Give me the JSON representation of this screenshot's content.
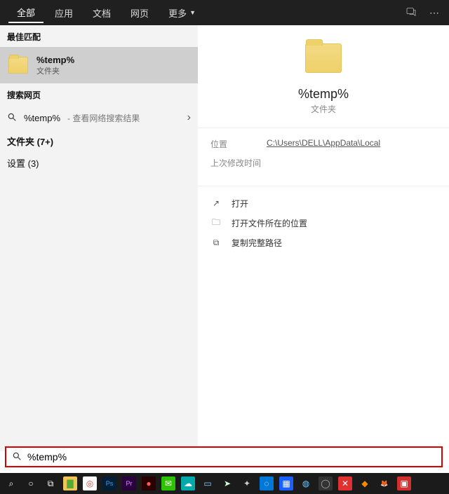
{
  "tabs": {
    "all": "全部",
    "apps": "应用",
    "docs": "文档",
    "web": "网页",
    "more": "更多"
  },
  "left": {
    "best_match_header": "最佳匹配",
    "result_title": "%temp%",
    "result_sub": "文件夹",
    "search_web_header": "搜索网页",
    "web_term": "%temp%",
    "web_suffix": " - 查看网络搜索结果",
    "folder_header": "文件夹 (7+)",
    "settings_header": "设置 (3)"
  },
  "preview": {
    "title": "%temp%",
    "sub": "文件夹",
    "meta_location_label": "位置",
    "meta_location_value": "C:\\Users\\DELL\\AppData\\Local",
    "meta_modified_label": "上次修改时间",
    "action_open": "打开",
    "action_open_location": "打开文件所在的位置",
    "action_copy_path": "复制完整路径"
  },
  "search_input_value": "%temp%",
  "taskbar": {
    "icons": [
      {
        "name": "search",
        "bg": "",
        "fg": "#fff",
        "glyph": "⌕"
      },
      {
        "name": "cortana",
        "bg": "",
        "fg": "#fff",
        "glyph": "○"
      },
      {
        "name": "taskview",
        "bg": "",
        "fg": "#fff",
        "glyph": "⧉"
      },
      {
        "name": "explorer",
        "bg": "#f2c558",
        "fg": "#5a3",
        "glyph": "▇"
      },
      {
        "name": "chrome",
        "bg": "#fff",
        "fg": "#e04030",
        "glyph": "◎"
      },
      {
        "name": "photoshop",
        "bg": "#001e36",
        "fg": "#31a8ff",
        "glyph": "Ps"
      },
      {
        "name": "premiere",
        "bg": "#2a003f",
        "fg": "#e085ff",
        "glyph": "Pr"
      },
      {
        "name": "app-red",
        "bg": "#2a0000",
        "fg": "#ff5a5a",
        "glyph": "●"
      },
      {
        "name": "wechat",
        "bg": "#2dc100",
        "fg": "#fff",
        "glyph": "✉"
      },
      {
        "name": "cloud",
        "bg": "#0aa",
        "fg": "#fff",
        "glyph": "☁"
      },
      {
        "name": "monitor",
        "bg": "#1b1b1b",
        "fg": "#8cf",
        "glyph": "▭"
      },
      {
        "name": "steam",
        "bg": "#1b1b1b",
        "fg": "#cfd",
        "glyph": "➤"
      },
      {
        "name": "puzzle",
        "bg": "#1b1b1b",
        "fg": "#ccc",
        "glyph": "✦"
      },
      {
        "name": "blue-circle",
        "bg": "#0078d7",
        "fg": "#fff",
        "glyph": "◌"
      },
      {
        "name": "grid",
        "bg": "#1b60ff",
        "fg": "#fff",
        "glyph": "▦"
      },
      {
        "name": "globe",
        "bg": "#1b1b1b",
        "fg": "#6cf",
        "glyph": "◍"
      },
      {
        "name": "disc",
        "bg": "#333",
        "fg": "#aaa",
        "glyph": "◯"
      },
      {
        "name": "red-x",
        "bg": "#e03030",
        "fg": "#fff",
        "glyph": "✕"
      },
      {
        "name": "orange",
        "bg": "#1b1b1b",
        "fg": "#f80",
        "glyph": "◆"
      },
      {
        "name": "firefox",
        "bg": "#1b1b1b",
        "fg": "#ff8a00",
        "glyph": "🦊"
      },
      {
        "name": "red-square",
        "bg": "#d03030",
        "fg": "#fff",
        "glyph": "▣"
      }
    ]
  }
}
